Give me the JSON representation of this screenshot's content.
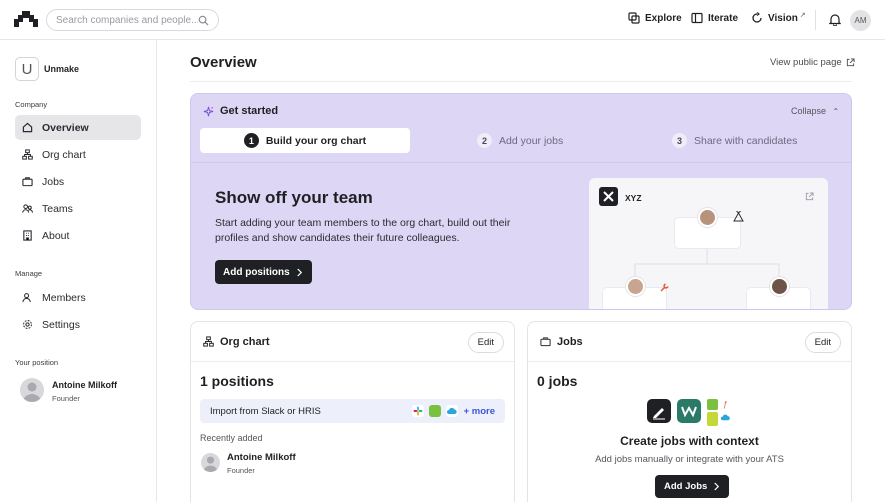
{
  "header": {
    "search_placeholder": "Search companies and people...",
    "nav": [
      {
        "label": "Explore",
        "icon": "explore-icon"
      },
      {
        "label": "Iterate",
        "icon": "iterate-icon"
      },
      {
        "label": "Vision",
        "icon": "vision-icon"
      }
    ],
    "user_initials": "AM"
  },
  "sidebar": {
    "org_initial": "U",
    "org_name": "Unmake",
    "company_label": "Company",
    "company_items": [
      {
        "label": "Overview",
        "icon": "home-icon",
        "active": true
      },
      {
        "label": "Org chart",
        "icon": "org-chart-icon"
      },
      {
        "label": "Jobs",
        "icon": "briefcase-icon"
      },
      {
        "label": "Teams",
        "icon": "teams-icon"
      },
      {
        "label": "About",
        "icon": "building-icon"
      }
    ],
    "manage_label": "Manage",
    "manage_items": [
      {
        "label": "Members",
        "icon": "members-icon"
      },
      {
        "label": "Settings",
        "icon": "gear-icon"
      }
    ],
    "position_label": "Your position",
    "me": {
      "name": "Antoine Milkoff",
      "role": "Founder"
    }
  },
  "main": {
    "title": "Overview",
    "view_public": "View public page",
    "get_started": {
      "title": "Get started",
      "collapse": "Collapse",
      "steps": [
        {
          "num": "1",
          "label": "Build your org chart"
        },
        {
          "num": "2",
          "label": "Add your jobs"
        },
        {
          "num": "3",
          "label": "Share with candidates"
        }
      ],
      "heading": "Show off your team",
      "description": "Start adding your team members to the org chart, build out their profiles and show candidates their future colleagues.",
      "cta": "Add positions",
      "preview_company": "XYZ"
    },
    "org_card": {
      "title": "Org chart",
      "edit": "Edit",
      "count": "1 positions",
      "import_label": "Import from Slack or HRIS",
      "more": "+ more",
      "recent_label": "Recently added",
      "person": {
        "name": "Antoine Milkoff",
        "role": "Founder"
      }
    },
    "jobs_card": {
      "title": "Jobs",
      "edit": "Edit",
      "count": "0 jobs",
      "create_title": "Create jobs with context",
      "create_desc": "Add jobs manually or integrate with your ATS",
      "cta": "Add Jobs"
    }
  },
  "colors": {
    "get_started_bg": "#ddd6f5",
    "primary_button": "#1f2023",
    "link": "#3b55d9"
  }
}
